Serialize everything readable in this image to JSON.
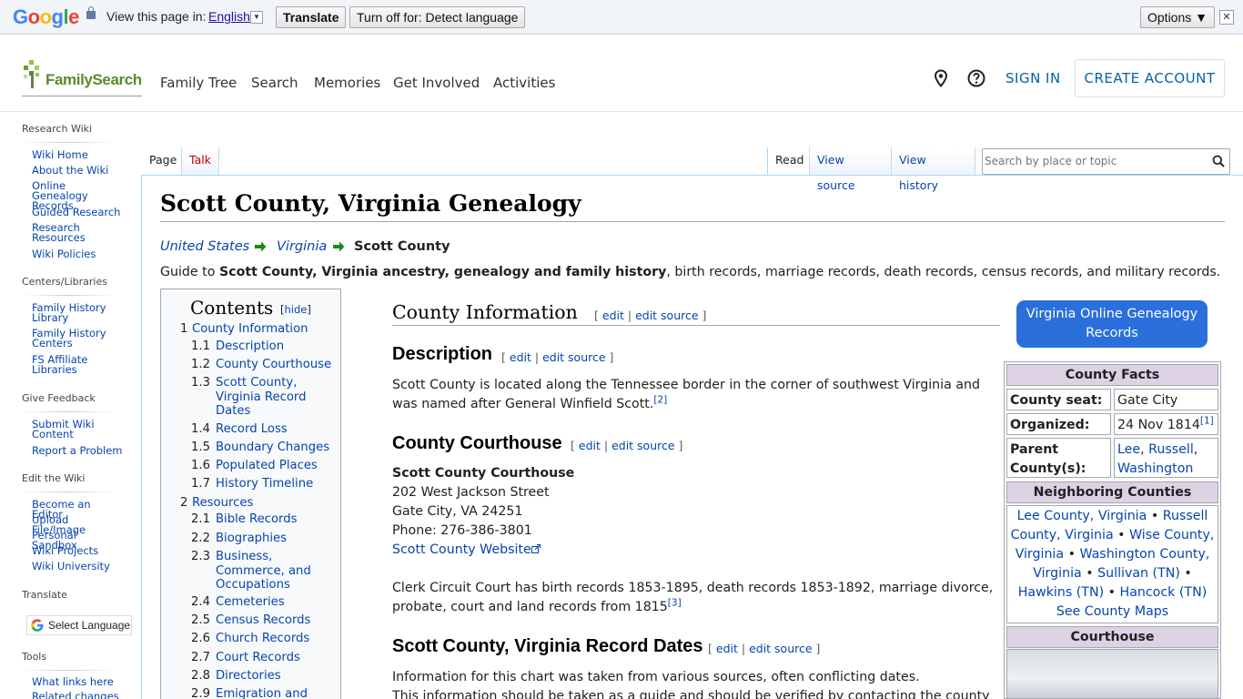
{
  "translate_bar": {
    "logo_letters": [
      "G",
      "o",
      "o",
      "g",
      "l",
      "e"
    ],
    "view_label": "View this page in:",
    "language": "English",
    "dropdown_glyph": "▼",
    "translate_btn": "Translate",
    "turnoff_btn": "Turn off for: Detect language",
    "options_btn": "Options ▼",
    "close_glyph": "✕"
  },
  "header": {
    "logo": "FamilySearch",
    "nav": [
      "Family Tree",
      "Search",
      "Memories",
      "Get Involved",
      "Activities"
    ],
    "sign_in": "SIGN IN",
    "create_account": "CREATE ACCOUNT",
    "icons": [
      "location-pin-icon",
      "help-icon"
    ]
  },
  "sidebar": {
    "research_wiki": "Research Wiki",
    "research_items": [
      "Wiki Home",
      "About the Wiki",
      "Online Genealogy Records",
      "Guided Research",
      "Research Resources",
      "Wiki Policies"
    ],
    "centers_heading": "Centers/Libraries",
    "centers_items": [
      "Family History Library",
      "Family History Centers",
      "FS Affiliate Libraries"
    ],
    "feedback_heading": "Give Feedback",
    "feedback_items": [
      "Submit Wiki Content",
      "Report a Problem"
    ],
    "edit_heading": "Edit the Wiki",
    "edit_items": [
      "Become an Editor",
      "Upload File/Image",
      "Personal Sandbox",
      "Wiki Projects",
      "Wiki University"
    ],
    "translate_heading": "Translate",
    "select_language": "Select Language",
    "tools_heading": "Tools",
    "tools_items": [
      "What links here",
      "Related changes"
    ]
  },
  "tabs": {
    "page": "Page",
    "talk": "Talk",
    "read": "Read",
    "view_source": "View source",
    "view_history": "View history",
    "search_placeholder": "Search by place or topic"
  },
  "article": {
    "title": "Scott County, Virginia Genealogy",
    "breadcrumb": [
      "United States",
      "Virginia",
      "Scott County"
    ],
    "guide_prefix": "Guide to ",
    "guide_bold": "Scott County, Virginia ancestry, genealogy and family history",
    "guide_suffix": ", birth records, marriage records, death records, census records, and military records.",
    "edit_open": "[",
    "edit": "edit",
    "edit_sep": "|",
    "edit_source": "edit source",
    "edit_close": "]",
    "county_info": "County Information",
    "description_h": "Description",
    "description_text": "Scott County is located along the Tennessee border in the corner of southwest Virginia and was named after General Winfield Scott.",
    "ref2": "[2]",
    "courthouse_h": "County Courthouse",
    "courthouse_name": "Scott County Courthouse",
    "courthouse_street": "202 West Jackson Street",
    "courthouse_city": "Gate City, VA 24251",
    "courthouse_phone": "Phone: 276-386-3801",
    "courthouse_website": "Scott County Website",
    "clerk_text": "Clerk Circuit Court has birth records 1853-1895, death records 1853-1892, marriage divorce, probate, court and land records from 1815",
    "ref3": "[3]",
    "record_dates_h": "Scott County, Virginia Record Dates",
    "record_dates_text_1": "Information for this chart was taken from various sources, often conflicting dates.",
    "record_dates_text_2": "This information should be taken as a guide and should be verified by contacting the county"
  },
  "toc": {
    "title": "Contents",
    "hide_open": "[",
    "hide": "hide",
    "hide_close": "]",
    "items": [
      {
        "num": "1",
        "text": "County Information"
      },
      {
        "num": "1.1",
        "text": "Description"
      },
      {
        "num": "1.2",
        "text": "County Courthouse"
      },
      {
        "num": "1.3",
        "text": "Scott County, Virginia Record Dates"
      },
      {
        "num": "1.4",
        "text": "Record Loss"
      },
      {
        "num": "1.5",
        "text": "Boundary Changes"
      },
      {
        "num": "1.6",
        "text": "Populated Places"
      },
      {
        "num": "1.7",
        "text": "History Timeline"
      },
      {
        "num": "2",
        "text": "Resources"
      },
      {
        "num": "2.1",
        "text": "Bible Records"
      },
      {
        "num": "2.2",
        "text": "Biographies"
      },
      {
        "num": "2.3",
        "text": "Business, Commerce, and Occupations"
      },
      {
        "num": "2.4",
        "text": "Cemeteries"
      },
      {
        "num": "2.5",
        "text": "Census Records"
      },
      {
        "num": "2.6",
        "text": "Church Records"
      },
      {
        "num": "2.7",
        "text": "Court Records"
      },
      {
        "num": "2.8",
        "text": "Directories"
      },
      {
        "num": "2.9",
        "text": "Emigration and"
      }
    ]
  },
  "infobox": {
    "online_btn": "Virginia Online Genealogy Records",
    "facts_h": "County Facts",
    "seat_label": "County seat:",
    "seat_value": "Gate City",
    "organized_label": "Organized:",
    "organized_value": "24 Nov 1814",
    "ref1": "[1]",
    "parent_label": "Parent County(s):",
    "parent_values": [
      "Lee",
      "Russell",
      "Washington"
    ],
    "parent_sep": ", ",
    "neighboring_h": "Neighboring Counties",
    "neighbors": [
      "Lee County, Virginia",
      "Russell County, Virginia",
      "Wise County, Virginia",
      "Washington County, Virginia",
      "Sullivan (TN)",
      "Hawkins (TN)",
      "Hancock (TN)"
    ],
    "bullet": "•",
    "maps_link": "See County Maps",
    "courthouse_h": "Courthouse"
  },
  "colors": {
    "accent": "#0063a2",
    "link": "#0645ad",
    "button_blue": "#2a6fdb",
    "fs_green": "#5b8a2c"
  }
}
